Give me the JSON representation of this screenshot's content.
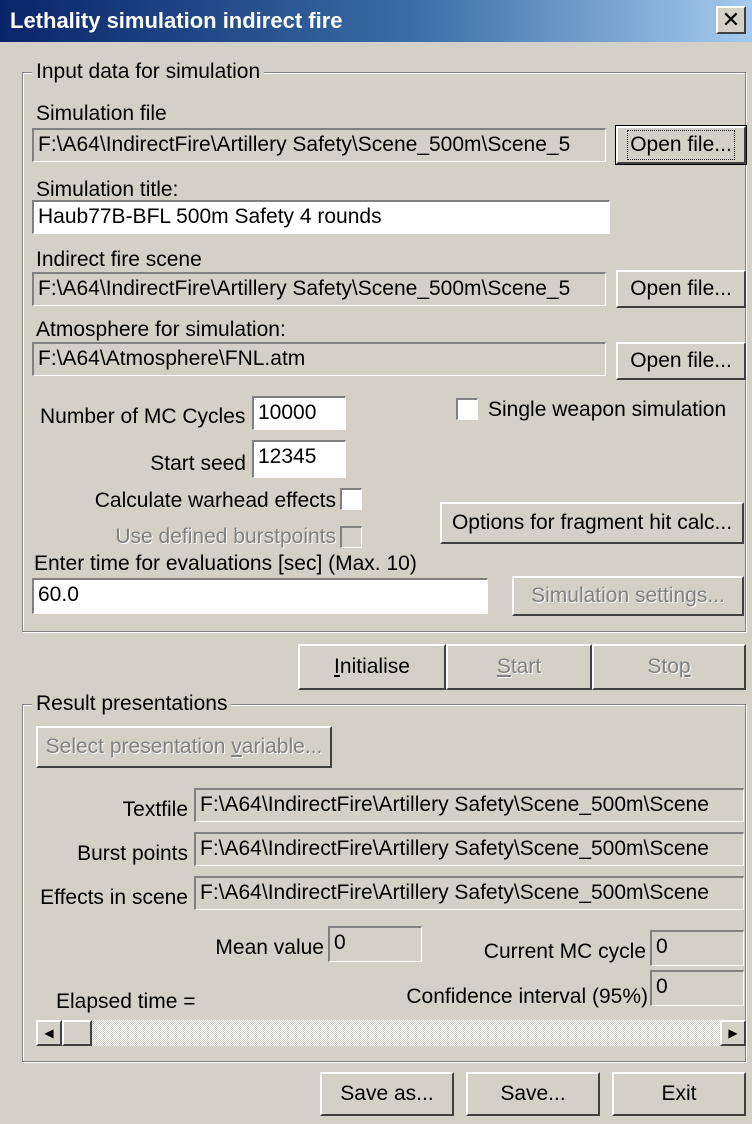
{
  "window": {
    "title": "Lethality simulation indirect fire",
    "close_glyph": "✕"
  },
  "input_group": {
    "legend": "Input data for simulation",
    "simulation_file_label": "Simulation file",
    "simulation_file_value": "F:\\A64\\IndirectFire\\Artillery Safety\\Scene_500m\\Scene_5",
    "open_file_label": "Open file...",
    "simulation_title_label": "Simulation title:",
    "simulation_title_value": "Haub77B-BFL 500m Safety 4 rounds",
    "scene_label": "Indirect fire scene",
    "scene_value": "F:\\A64\\IndirectFire\\Artillery Safety\\Scene_500m\\Scene_5",
    "atmosphere_label": "Atmosphere for simulation:",
    "atmosphere_value": "F:\\A64\\Atmosphere\\FNL.atm",
    "mc_cycles_label": "Number of MC Cycles",
    "mc_cycles_value": "10000",
    "start_seed_label": "Start seed",
    "start_seed_value": "12345",
    "single_weapon_label": "Single weapon simulation",
    "calc_warhead_label": "Calculate warhead effects",
    "use_burstpoints_label": "Use defined burstpoints",
    "fragment_hit_button": "Options for fragment hit calc...",
    "eval_time_label": "Enter time for evaluations [sec] (Max. 10)",
    "eval_time_value": "60.0",
    "sim_settings_button": "Simulation settings..."
  },
  "run_buttons": {
    "initialise": "Initialise",
    "start": "Start",
    "stop": "Stop"
  },
  "results_group": {
    "legend": "Result presentations",
    "select_variable_button": "Select presentation variable...",
    "textfile_label": "Textfile",
    "textfile_value": "F:\\A64\\IndirectFire\\Artillery Safety\\Scene_500m\\Scene",
    "burst_points_label": "Burst points",
    "burst_points_value": "F:\\A64\\IndirectFire\\Artillery Safety\\Scene_500m\\Scene",
    "effects_label": "Effects in scene",
    "effects_value": "F:\\A64\\IndirectFire\\Artillery Safety\\Scene_500m\\Scene",
    "mean_value_label": "Mean value",
    "mean_value": "0",
    "current_mc_label": "Current MC cycle",
    "current_mc_value": "0",
    "confidence_label": "Confidence interval (95%)",
    "confidence_value": "0",
    "elapsed_label": "Elapsed time ="
  },
  "footer_buttons": {
    "save_as": "Save as...",
    "save": "Save...",
    "exit": "Exit"
  }
}
